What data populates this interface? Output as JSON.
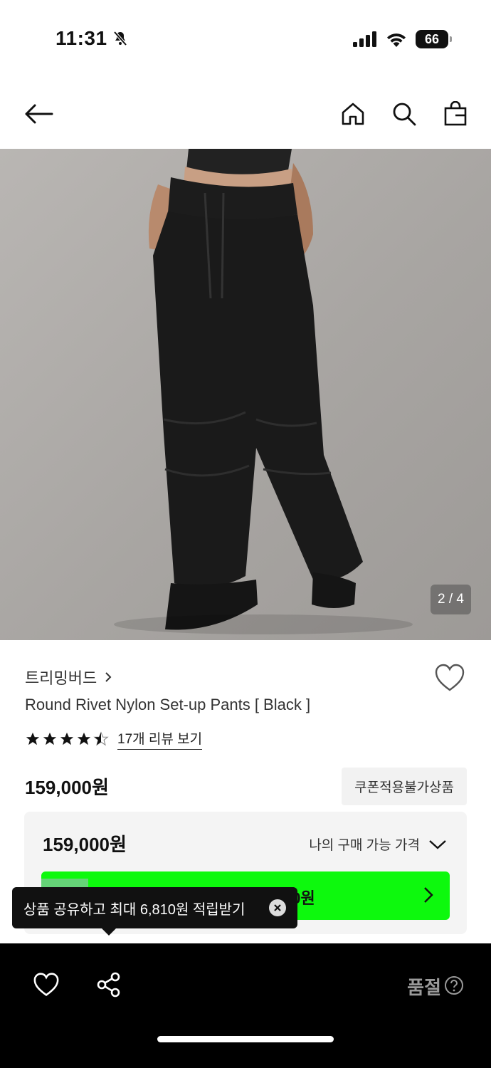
{
  "status_bar": {
    "time": "11:31",
    "battery": "66"
  },
  "product": {
    "image_counter": "2 / 4",
    "brand": "트리밍버드",
    "name": "Round Rivet Nylon Set-up Pants [ Black ]",
    "rating_stars": 4.5,
    "review_link": "17개 리뷰 보기",
    "price": "159,000원",
    "coupon_badge": "쿠폰적용불가상품"
  },
  "price_box": {
    "price": "159,000원",
    "label": "나의 구매 가능 가격",
    "green_text": "00원"
  },
  "tooltip": {
    "text": "상품 공유하고 최대 6,810원 적립받기"
  },
  "bottom_bar": {
    "soldout_label": "품절"
  }
}
